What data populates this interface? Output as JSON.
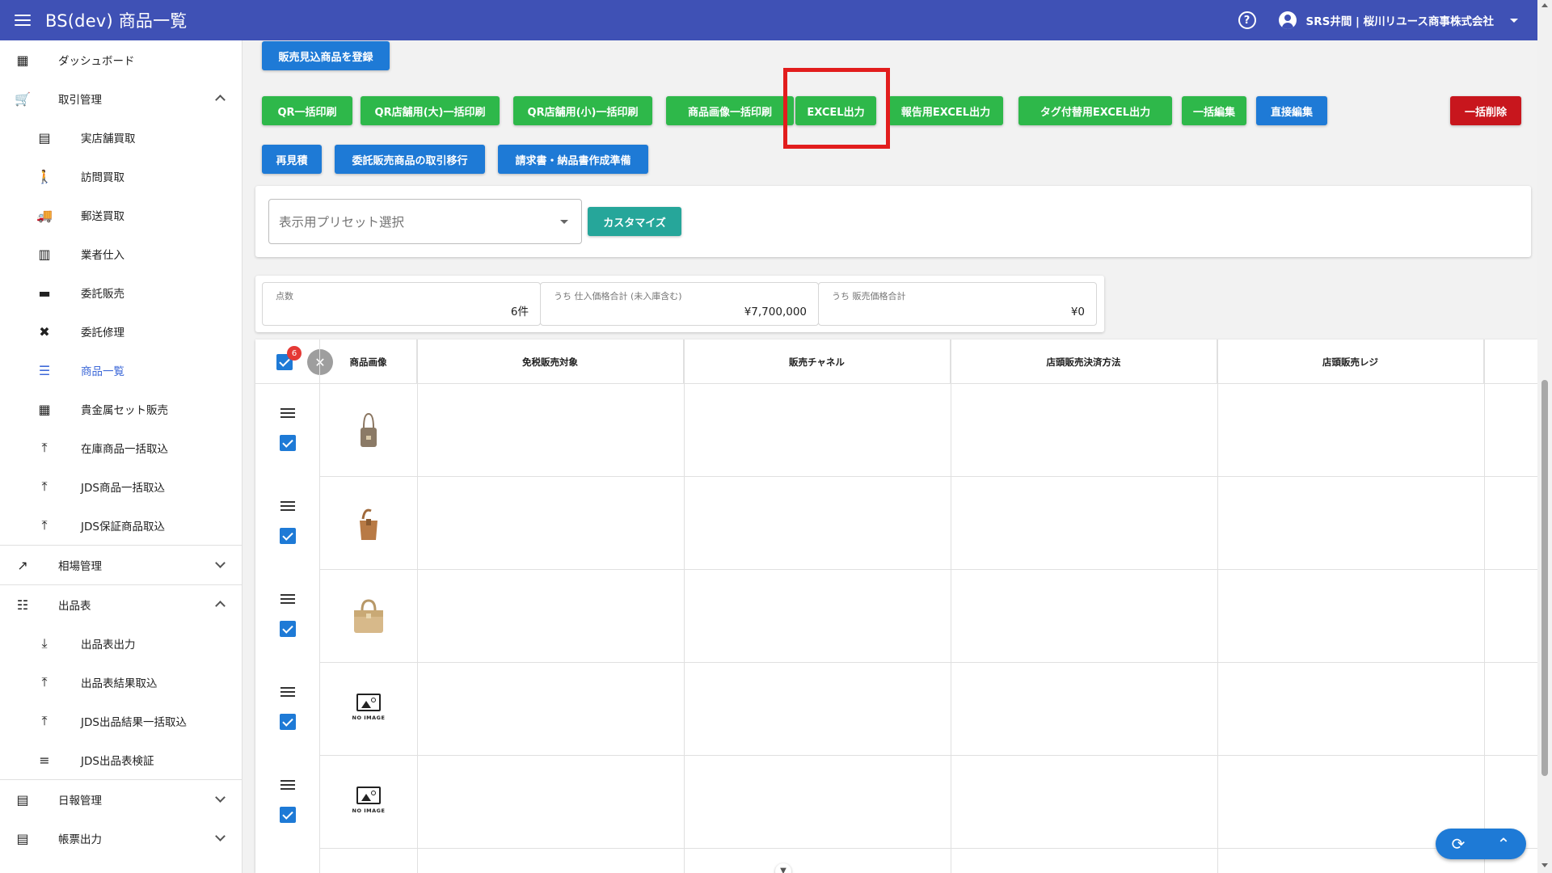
{
  "app": {
    "title": "BS(dev) 商品一覧",
    "account": "SRS井間 | 桜川リユース商事株式会社",
    "help_glyph": "?"
  },
  "sidebar": {
    "items": [
      {
        "label": "ダッシュボード",
        "icon": "dashboard-icon",
        "glyph": "▦",
        "level": "top"
      },
      {
        "label": "取引管理",
        "icon": "cart-icon",
        "glyph": "🛒",
        "level": "top",
        "expand": "up"
      },
      {
        "label": "実店舗買取",
        "icon": "store-icon",
        "glyph": "▤",
        "level": "sub"
      },
      {
        "label": "訪問買取",
        "icon": "walk-icon",
        "glyph": "🚶",
        "level": "sub"
      },
      {
        "label": "郵送買取",
        "icon": "truck-icon",
        "glyph": "🚚",
        "level": "sub"
      },
      {
        "label": "業者仕入",
        "icon": "building-icon",
        "glyph": "▥",
        "level": "sub"
      },
      {
        "label": "委託販売",
        "icon": "consign-icon",
        "glyph": "▬",
        "level": "sub"
      },
      {
        "label": "委託修理",
        "icon": "tools-icon",
        "glyph": "✖",
        "level": "sub"
      },
      {
        "label": "商品一覧",
        "icon": "list-icon",
        "glyph": "☰",
        "level": "sub",
        "active": true
      },
      {
        "label": "貴金属セット販売",
        "icon": "grid-icon",
        "glyph": "▦",
        "level": "sub"
      },
      {
        "label": "在庫商品一括取込",
        "icon": "upload-icon",
        "glyph": "⤒",
        "level": "sub"
      },
      {
        "label": "JDS商品一括取込",
        "icon": "upload-icon",
        "glyph": "⤒",
        "level": "sub"
      },
      {
        "label": "JDS保証商品取込",
        "icon": "upload-icon",
        "glyph": "⤒",
        "level": "sub"
      },
      {
        "label": "相場管理",
        "icon": "trending-icon",
        "glyph": "↗",
        "level": "top",
        "expand": "down",
        "divider": true
      },
      {
        "label": "出品表",
        "icon": "listalt-icon",
        "glyph": "☷",
        "level": "top",
        "expand": "up",
        "divider": true
      },
      {
        "label": "出品表出力",
        "icon": "download-icon",
        "glyph": "⤓",
        "level": "sub"
      },
      {
        "label": "出品表結果取込",
        "icon": "upload-icon",
        "glyph": "⤒",
        "level": "sub"
      },
      {
        "label": "JDS出品結果一括取込",
        "icon": "upload-icon",
        "glyph": "⤒",
        "level": "sub"
      },
      {
        "label": "JDS出品表検証",
        "icon": "checklist-icon",
        "glyph": "≡",
        "level": "sub"
      },
      {
        "label": "日報管理",
        "icon": "document-icon",
        "glyph": "▤",
        "level": "top",
        "expand": "down",
        "divider": true
      },
      {
        "label": "帳票出力",
        "icon": "note-icon",
        "glyph": "▤",
        "level": "top",
        "expand": "down"
      }
    ]
  },
  "toolbar": {
    "register_label": "販売見込商品を登録",
    "row1": [
      {
        "label": "QR一括印刷",
        "color": "green"
      },
      {
        "label": "QR店舗用(大)一括印刷",
        "color": "green"
      },
      {
        "label": "QR店舗用(小)一括印刷",
        "color": "green"
      },
      {
        "label": "商品画像一括印刷",
        "color": "green"
      },
      {
        "label": "EXCEL出力",
        "color": "green"
      },
      {
        "label": "報告用EXCEL出力",
        "color": "green"
      },
      {
        "label": "タグ付替用EXCEL出力",
        "color": "green"
      },
      {
        "label": "一括編集",
        "color": "green"
      },
      {
        "label": "直接編集",
        "color": "blue"
      },
      {
        "label": "一括削除",
        "color": "red"
      }
    ],
    "row2": [
      {
        "label": "再見積",
        "color": "blue"
      },
      {
        "label": "委託販売商品の取引移行",
        "color": "blue"
      },
      {
        "label": "請求書・納品書作成準備",
        "color": "blue"
      }
    ]
  },
  "preset": {
    "placeholder": "表示用プリセット選択",
    "customize_label": "カスタマイズ"
  },
  "summary": [
    {
      "label": "点数",
      "value": "6件"
    },
    {
      "label": "うち 仕入価格合計 (未入庫含む)",
      "value": "¥7,700,000"
    },
    {
      "label": "うち 販売価格合計",
      "value": "¥0"
    }
  ],
  "table": {
    "selected_count": "6",
    "columns": [
      "商品画像",
      "免税販売対象",
      "販売チャネル",
      "店頭販売決済方法",
      "店頭販売レジ"
    ],
    "rows": [
      {
        "image": "bag-constance",
        "checked": true
      },
      {
        "image": "bag-picotin",
        "checked": true
      },
      {
        "image": "bag-birkin",
        "checked": true
      },
      {
        "image": "no-image",
        "checked": true
      },
      {
        "image": "no-image",
        "checked": true
      }
    ],
    "no_image_text": "NO IMAGE"
  },
  "colors": {
    "appbar": "#3f51b5",
    "green": "#2eb84a",
    "blue": "#1e7ad6",
    "red": "#c8161d",
    "teal": "#26a69a",
    "highlight": "#e21d1d"
  }
}
